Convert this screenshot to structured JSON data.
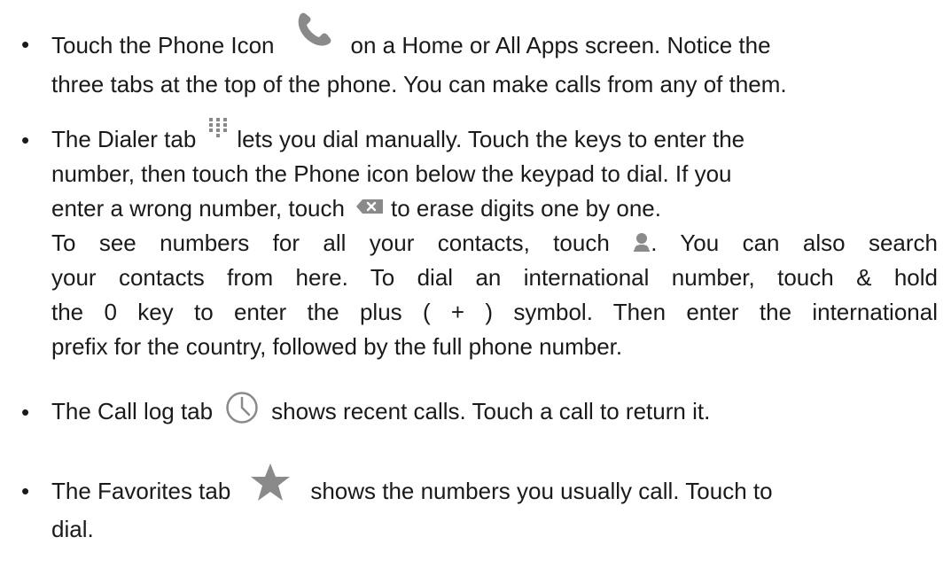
{
  "bullets": {
    "b1": {
      "marker": "•",
      "text_a": "Touch the Phone Icon",
      "text_b": "on a Home or All Apps screen. Notice the",
      "text_c": "three tabs at the top of the phone. You can make calls from any of them.",
      "icon": "phone-handset-icon"
    },
    "b2": {
      "marker": "•",
      "text_a": "The Dialer tab",
      "text_b": "lets you dial manually. Touch the keys to enter the",
      "text_c": "number, then touch the Phone icon below the keypad to dial. If you",
      "text_d": "enter a wrong number, touch",
      "text_e": "to erase digits one by one.",
      "text_f": "To see numbers for all your contacts, touch",
      "text_g": ". You can also search",
      "text_h": "your contacts from here. To dial an international number, touch & hold",
      "text_i": "the 0 key to enter the plus ( + ) symbol. Then enter the international",
      "text_j": "prefix for the country, followed by the full phone number.",
      "icons": [
        "dialpad-icon",
        "backspace-icon",
        "contact-person-icon"
      ]
    },
    "b3": {
      "marker": "•",
      "text_a": "The Call log tab",
      "text_b": "shows recent calls. Touch a call to return it.",
      "icon": "clock-icon"
    },
    "b4": {
      "marker": "•",
      "text_a": "The Favorites tab",
      "text_b": "shows the numbers you usually call. Touch to",
      "text_c": "dial.",
      "icon": "star-icon"
    }
  },
  "colors": {
    "text": "#1a1a1a",
    "icon_gray": "#8a8a8a"
  }
}
